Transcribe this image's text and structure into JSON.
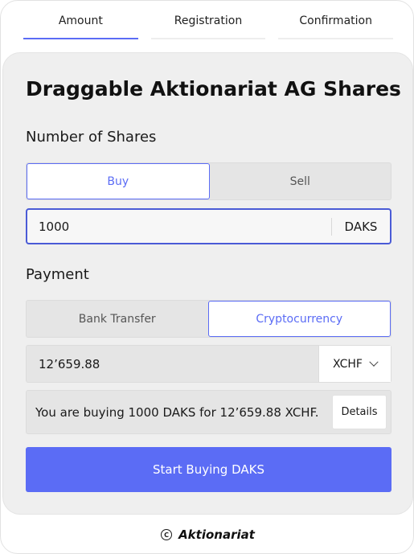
{
  "steps": [
    {
      "label": "Amount",
      "active": true
    },
    {
      "label": "Registration",
      "active": false
    },
    {
      "label": "Confirmation",
      "active": false
    }
  ],
  "card": {
    "title": "Draggable Aktionariat AG Shares",
    "shares_label": "Number of Shares",
    "trade_options": {
      "buy": "Buy",
      "sell": "Sell",
      "selected": "Buy"
    },
    "amount": {
      "value": "1000",
      "unit": "DAKS"
    },
    "payment_label": "Payment",
    "payment_options": {
      "bank": "Bank Transfer",
      "crypto": "Cryptocurrency",
      "selected": "Cryptocurrency"
    },
    "payment": {
      "value": "12’659.88",
      "currency": "XCHF"
    },
    "summary": {
      "text": "You are buying 1000 DAKS for 12’659.88 XCHF.",
      "details_label": "Details"
    },
    "cta_label": "Start Buying DAKS"
  },
  "footer": {
    "brand": "Aktionariat",
    "symbol": "©"
  },
  "colors": {
    "accent": "#5b6cf5",
    "card_bg": "#efefef"
  }
}
